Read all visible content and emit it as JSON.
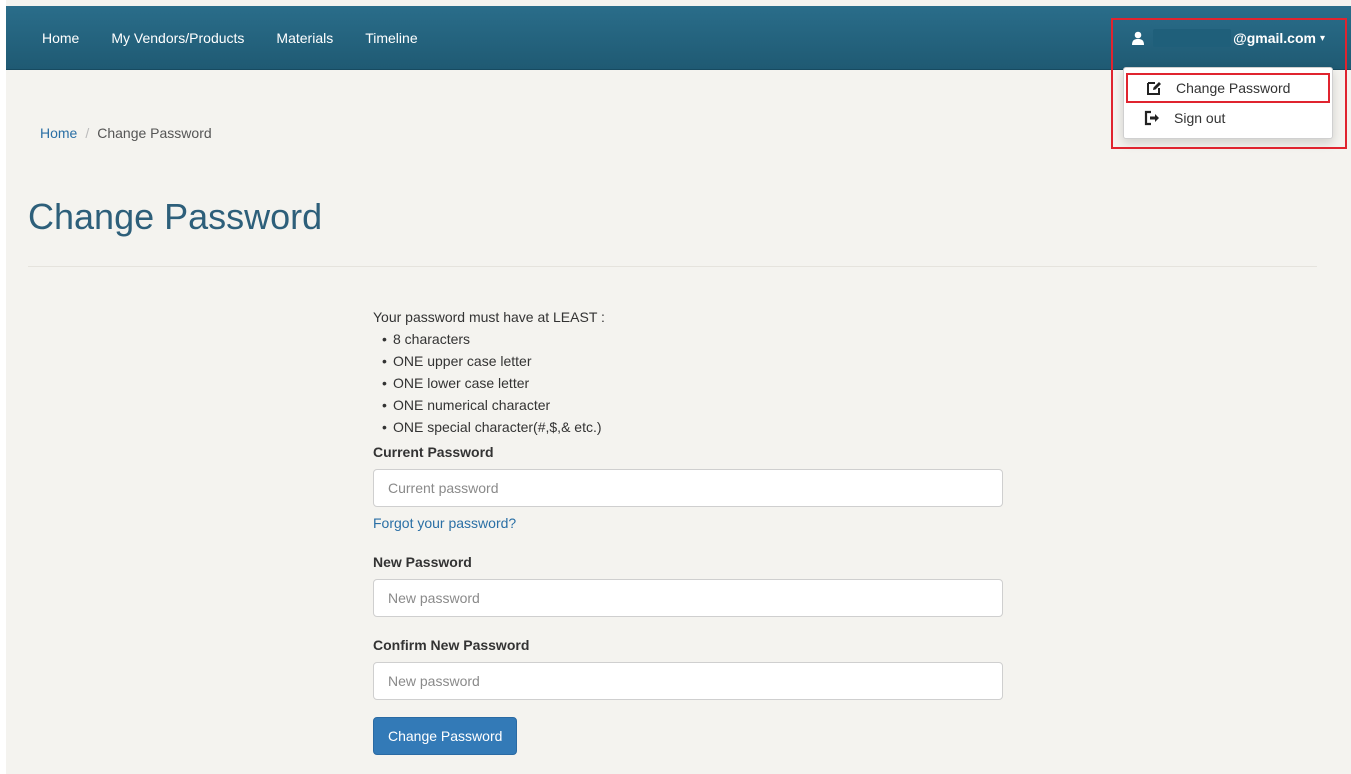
{
  "nav": {
    "items": [
      {
        "label": "Home"
      },
      {
        "label": "My Vendors/Products"
      },
      {
        "label": "Materials"
      },
      {
        "label": "Timeline"
      }
    ],
    "user_email_suffix": "@gmail.com",
    "user_icon": "user-icon",
    "caret": "▾"
  },
  "dropdown": {
    "items": [
      {
        "label": "Change Password",
        "icon": "edit-icon"
      },
      {
        "label": "Sign out",
        "icon": "sign-out-icon"
      }
    ]
  },
  "breadcrumb": {
    "home": "Home",
    "separator": "/",
    "current": "Change Password"
  },
  "page": {
    "title": "Change Password"
  },
  "requirements": {
    "intro": "Your password must have at LEAST :",
    "items": [
      "8 characters",
      "ONE upper case letter",
      "ONE lower case letter",
      "ONE numerical character",
      "ONE special character(#,$,& etc.)"
    ]
  },
  "form": {
    "current_label": "Current Password",
    "current_placeholder": "Current password",
    "forgot_link": "Forgot your password?",
    "new_label": "New Password",
    "new_placeholder": "New password",
    "confirm_label": "Confirm New Password",
    "confirm_placeholder": "New password",
    "submit_label": "Change Password"
  },
  "colors": {
    "navbar": "#2a6d8a",
    "link": "#2a6fa5",
    "primary_button": "#337ab7",
    "annotation": "#e0242f",
    "title": "#2d5f7a"
  }
}
